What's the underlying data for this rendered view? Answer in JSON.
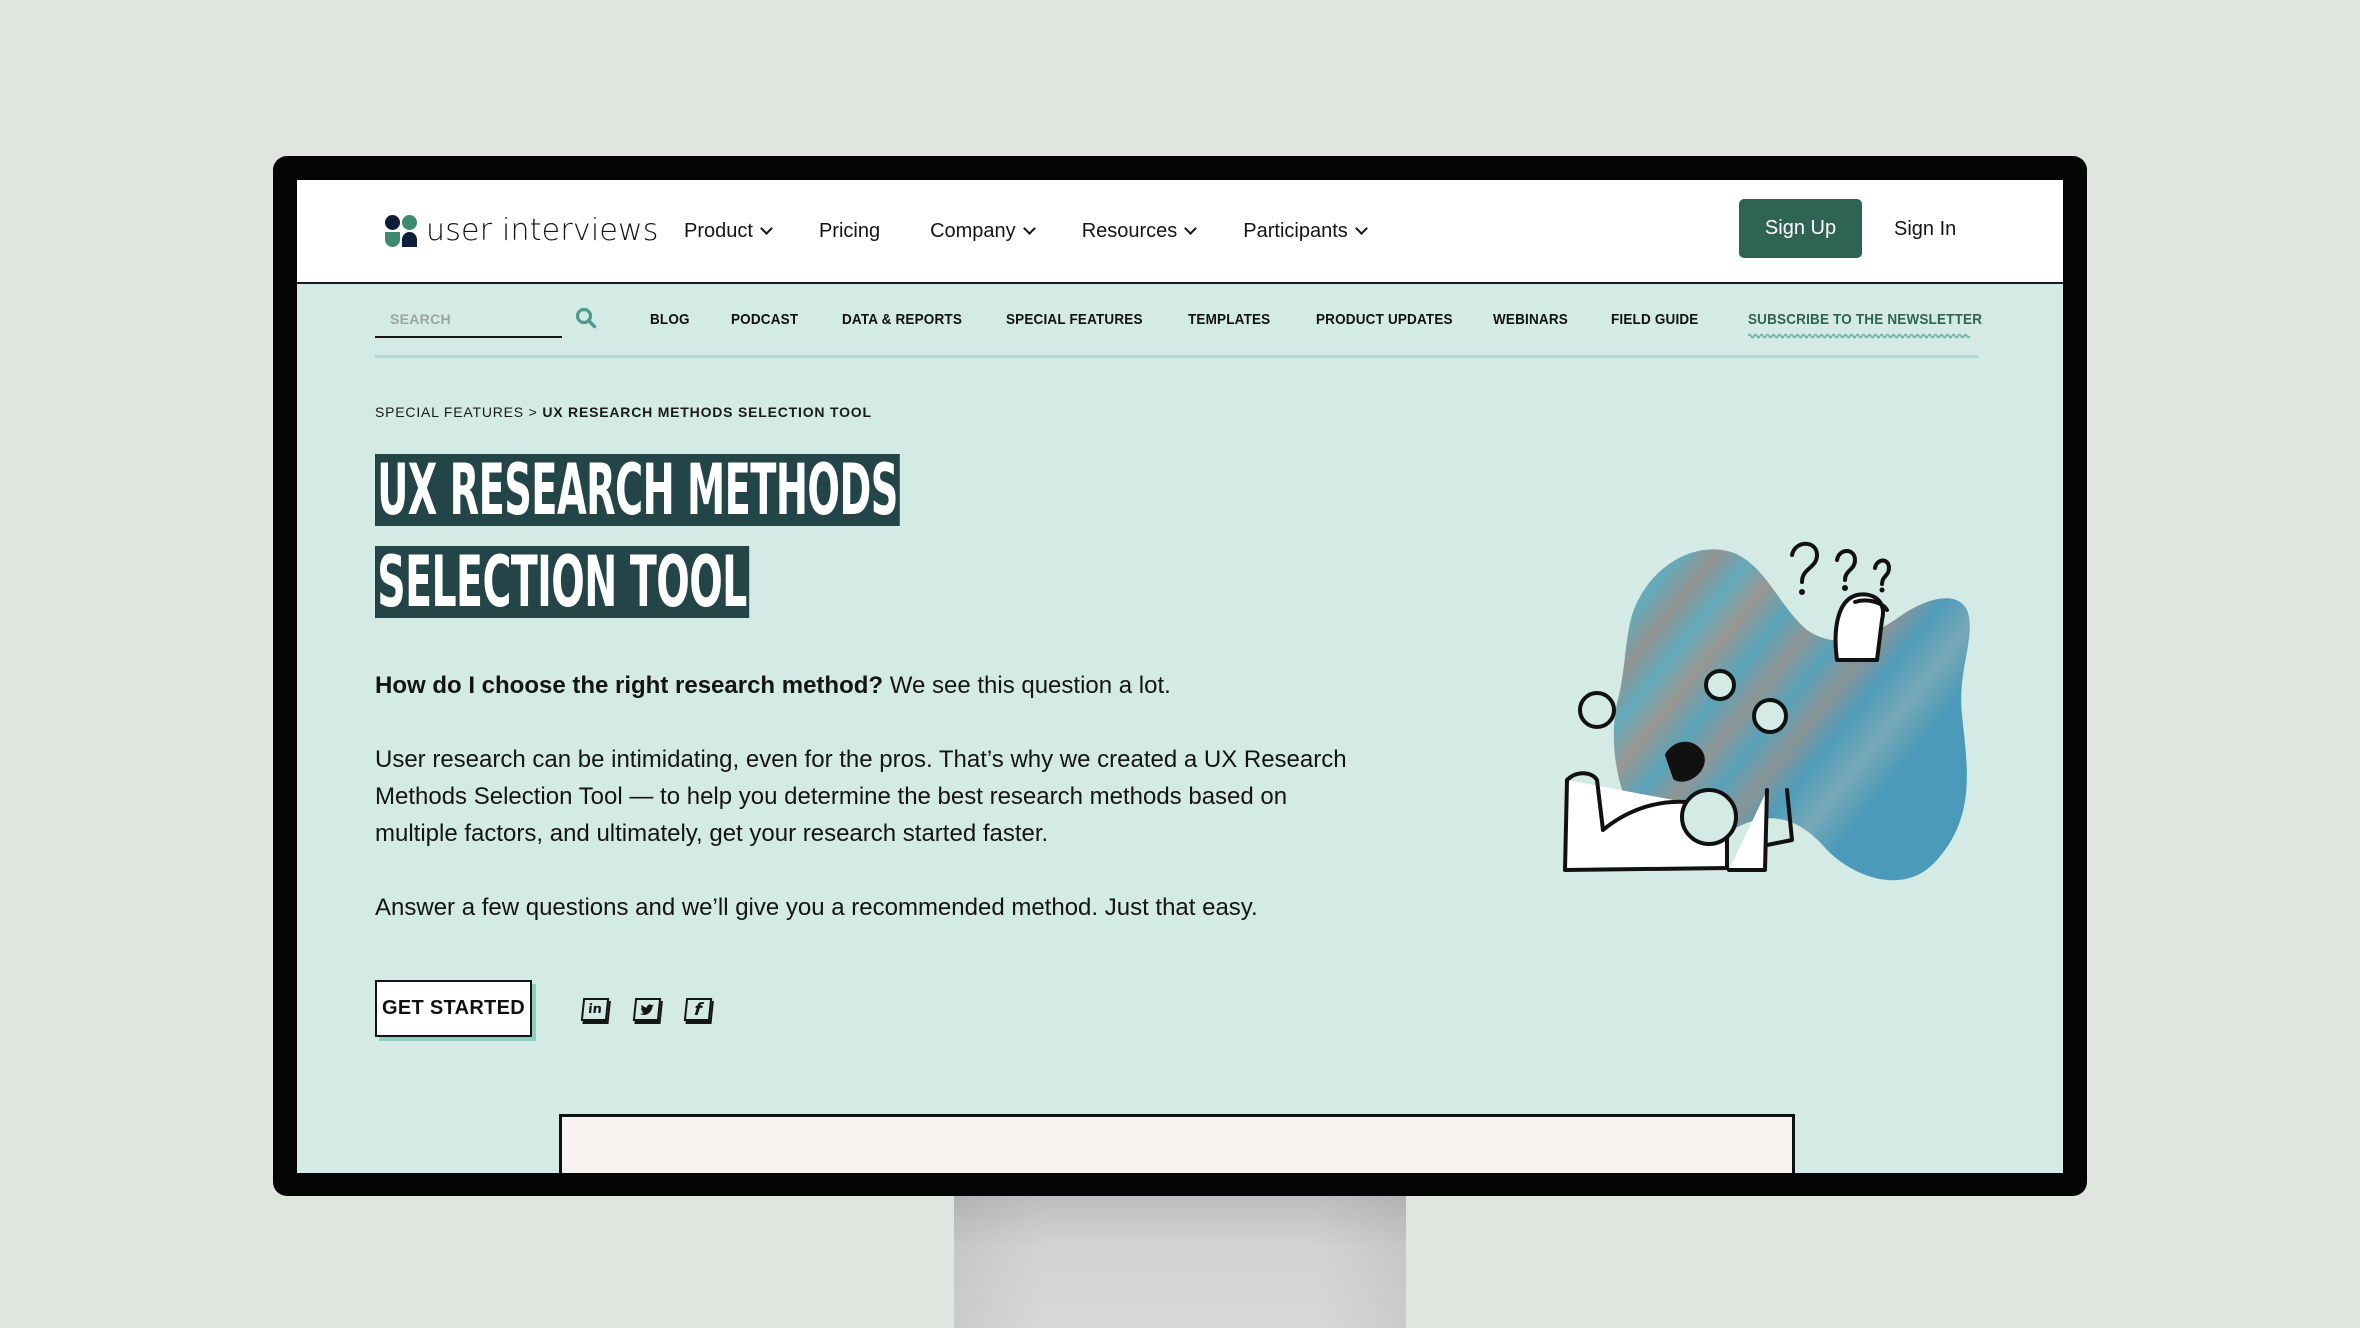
{
  "brand": {
    "name": "user interviews",
    "colors": {
      "primary": "#2f6354",
      "title_bg": "#234547",
      "page_bg": "#d4eae4",
      "accent_shadow": "#8ccfbc"
    }
  },
  "header": {
    "nav": [
      {
        "label": "Product",
        "has_dropdown": true
      },
      {
        "label": "Pricing",
        "has_dropdown": false
      },
      {
        "label": "Company",
        "has_dropdown": true
      },
      {
        "label": "Resources",
        "has_dropdown": true
      },
      {
        "label": "Participants",
        "has_dropdown": true
      }
    ],
    "signup_label": "Sign Up",
    "signin_label": "Sign In"
  },
  "subnav": {
    "search_placeholder": "SEARCH",
    "links": [
      "BLOG",
      "PODCAST",
      "DATA & REPORTS",
      "SPECIAL FEATURES",
      "TEMPLATES",
      "PRODUCT UPDATES",
      "WEBINARS",
      "FIELD GUIDE"
    ],
    "newsletter_label": "SUBSCRIBE TO THE NEWSLETTER"
  },
  "breadcrumb": {
    "parent": "SPECIAL FEATURES",
    "separator": " > ",
    "current": "UX RESEARCH METHODS SELECTION TOOL"
  },
  "hero": {
    "title_line1": "UX RESEARCH METHODS",
    "title_line2": "SELECTION TOOL",
    "intro_bold": "How do I choose the right research method?",
    "intro_rest": " We see this question a lot.",
    "paragraph2": "User research can be intimidating, even for the pros. That’s why we created a UX Research Methods Selection Tool — to help you determine the best research methods based on multiple factors, and ultimately, get your research started faster.",
    "paragraph3": "Answer a few questions and we’ll give you a recommended method. Just that easy.",
    "cta_label": "GET STARTED",
    "social": [
      {
        "name": "linkedin",
        "glyph": "in"
      },
      {
        "name": "twitter",
        "glyph": "🐦"
      },
      {
        "name": "facebook",
        "glyph": "f"
      }
    ]
  }
}
